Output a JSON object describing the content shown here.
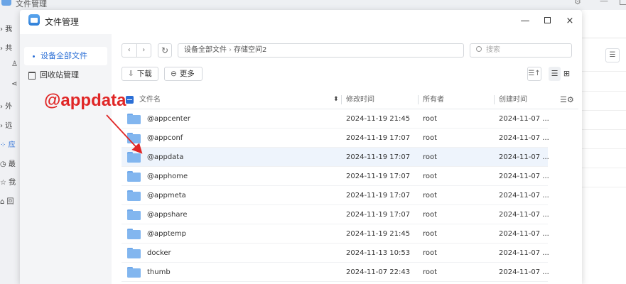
{
  "background_app": {
    "title": "文件管理",
    "sidebar": [
      "我",
      "共",
      "",
      "",
      "外",
      "远",
      "应",
      "最",
      "我",
      "回"
    ]
  },
  "window": {
    "title": "文件管理",
    "minimize": "—",
    "close": "×"
  },
  "nav": {
    "items": [
      {
        "label": "设备全部文件",
        "active": true
      },
      {
        "label": "回收站管理",
        "active": false
      }
    ]
  },
  "toolbar": {
    "back": "‹",
    "forward": "›",
    "refresh": "↻",
    "path": [
      "设备全部文件",
      "存储空间2"
    ],
    "path_sep": "›",
    "search_placeholder": "搜索",
    "download_label": "下载",
    "more_label": "更多",
    "download_icon": "⇩",
    "more_icon": "⊖"
  },
  "table": {
    "columns": {
      "name": "文件名",
      "modified": "修改时间",
      "owner": "所有者",
      "created": "创建时间"
    },
    "rows": [
      {
        "name": "@appcenter",
        "modified": "2024-11-19 21:45",
        "owner": "root",
        "created": "2024-11-07 ...",
        "selected": false
      },
      {
        "name": "@appconf",
        "modified": "2024-11-19 17:07",
        "owner": "root",
        "created": "2024-11-07 ...",
        "selected": false
      },
      {
        "name": "@appdata",
        "modified": "2024-11-19 17:07",
        "owner": "root",
        "created": "2024-11-07 ...",
        "selected": true
      },
      {
        "name": "@apphome",
        "modified": "2024-11-19 17:07",
        "owner": "root",
        "created": "2024-11-07 ...",
        "selected": false
      },
      {
        "name": "@appmeta",
        "modified": "2024-11-19 17:07",
        "owner": "root",
        "created": "2024-11-07 ...",
        "selected": false
      },
      {
        "name": "@appshare",
        "modified": "2024-11-19 17:07",
        "owner": "root",
        "created": "2024-11-07 ...",
        "selected": false
      },
      {
        "name": "@apptemp",
        "modified": "2024-11-19 21:45",
        "owner": "root",
        "created": "2024-11-07 ...",
        "selected": false
      },
      {
        "name": "docker",
        "modified": "2024-11-13 10:53",
        "owner": "root",
        "created": "2024-11-07 ...",
        "selected": false
      },
      {
        "name": "thumb",
        "modified": "2024-11-07 22:43",
        "owner": "root",
        "created": "2024-11-07 ...",
        "selected": false
      }
    ]
  },
  "annotation": {
    "text": "@appdata",
    "color": "#e02626"
  },
  "colors": {
    "accent": "#2b6fd6",
    "folder": "#82b6ef",
    "selected_row": "#eef4fc"
  }
}
